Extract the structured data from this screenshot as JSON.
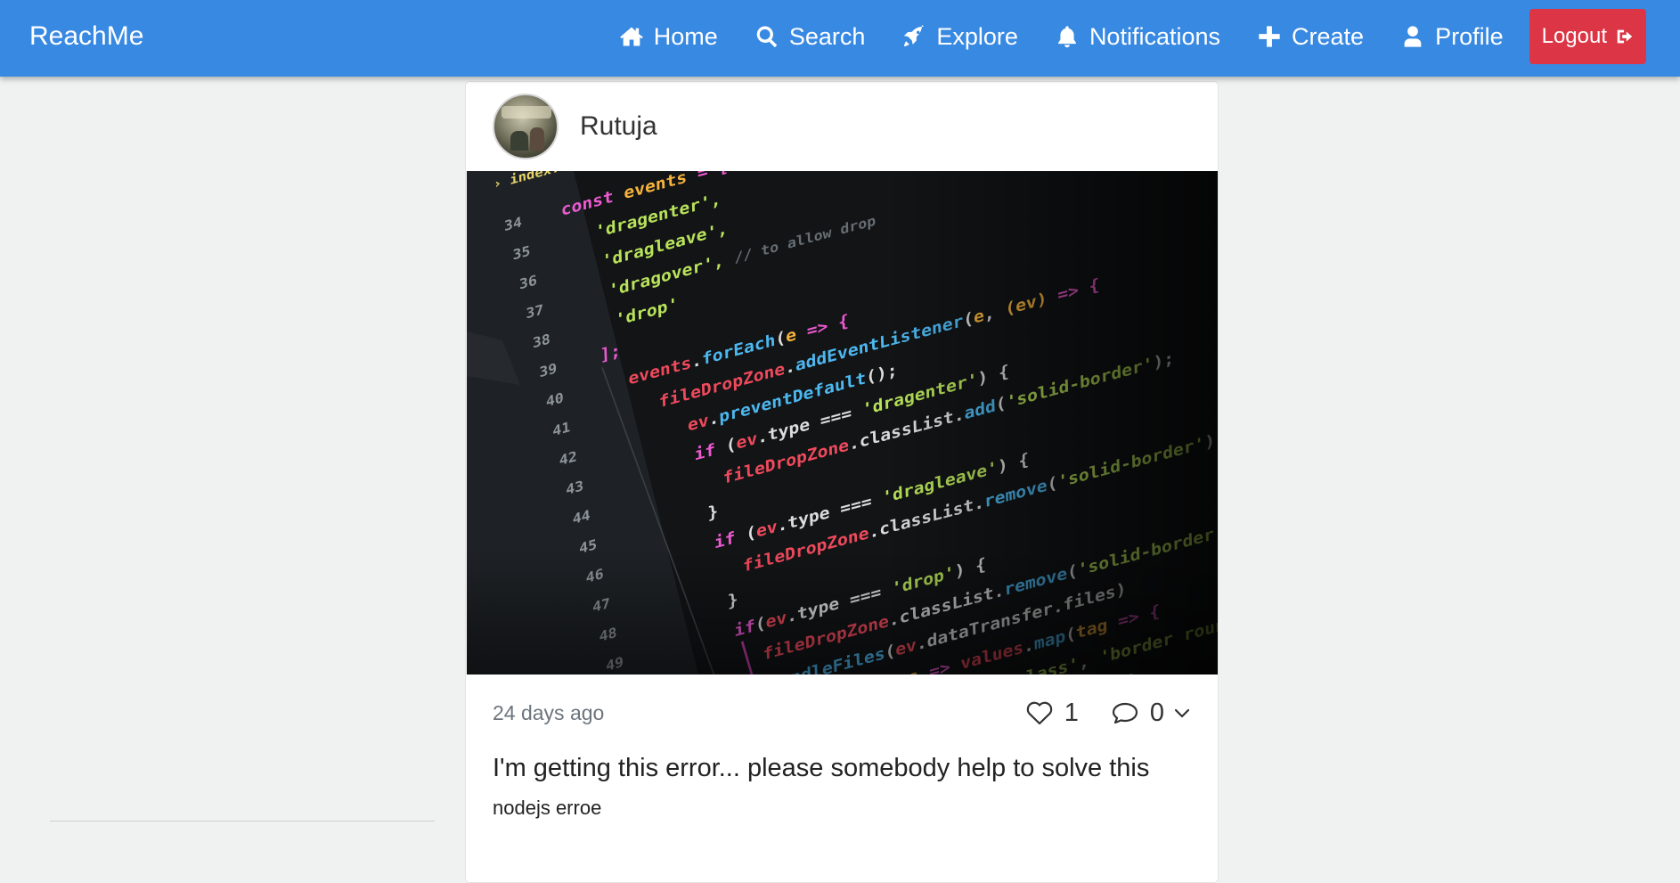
{
  "app": {
    "brand": "ReachMe"
  },
  "nav": {
    "items": [
      {
        "label": "Home",
        "icon": "home-icon"
      },
      {
        "label": "Search",
        "icon": "search-icon"
      },
      {
        "label": "Explore",
        "icon": "rocket-icon"
      },
      {
        "label": "Notifications",
        "icon": "bell-icon"
      },
      {
        "label": "Create",
        "icon": "plus-icon"
      },
      {
        "label": "Profile",
        "icon": "user-icon"
      }
    ],
    "logout_label": "Logout",
    "logout_icon": "sign-out-icon"
  },
  "post": {
    "author": "Rutuja",
    "timestamp": "24 days ago",
    "likes": "1",
    "comments": "0",
    "text": "I'm getting this error... please somebody help to solve this",
    "tags": "nodejs erroe"
  },
  "colors": {
    "navbar": "#3889e2",
    "logout": "#dc3545",
    "background": "#f0f2f1"
  }
}
